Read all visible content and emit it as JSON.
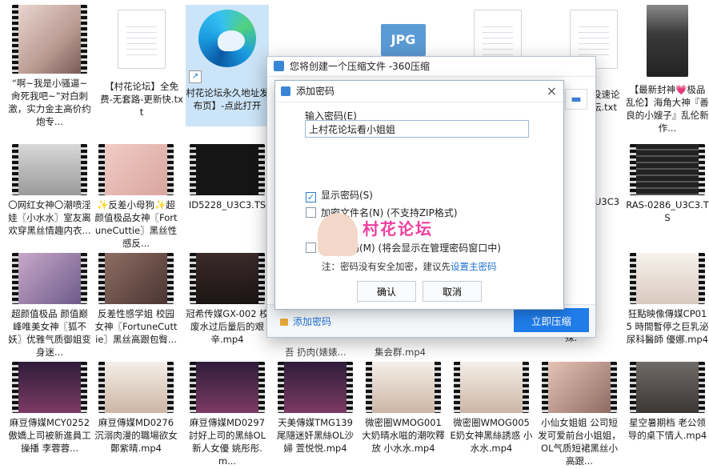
{
  "files": [
    {
      "label": "“啊~我是小骚逼~肏死我吧~”对白刺激，实力金主高价约炮专..."
    },
    {
      "label": "【村花论坛】全免费-无套路-更新快.txt"
    },
    {
      "label": "村花论坛永久地址发布页】-点此打开"
    },
    {
      "label": "JPG"
    },
    {
      "label": "没速论坛.txt"
    },
    {
      "label": "【最新封神💗极品乱伦】海角大神『善良的小嫂子』乱伦新作..."
    },
    {
      "label": "〇网红女神〇潮喷淫娃〖小水水〗室友离欢穿黑丝情趣内衣..."
    },
    {
      "label": "✨反差小母狗✨超颜值极品女神〖FortuneCuttie〗黑丝性感反..."
    },
    {
      "label": "ID5228_U3C3.TS"
    },
    {
      "label": "U3C3"
    },
    {
      "label": "RAS-0286_U3C3.TS"
    },
    {
      "label": "超颜值极品 颜值巅峰唯美女神〖狐不妖〗优雅气质御姐变身迷..."
    },
    {
      "label": "反差性感学姐 校园女神〖FortuneCuttie〗黑丝高跟包臀..."
    },
    {
      "label": "冠希传媒GX-002 校废水过后量后的艰辛.mp4"
    },
    {
      "label": "-035 体换 殊."
    },
    {
      "label": "狂點映像傳媒CP015 時間暫停之巨乳泌尿科醫師 優娜.mp4"
    },
    {
      "label": "麻豆傳媒MCY0252 傲嬌上司被新進員工操播 李蓉蓉..."
    },
    {
      "label": "麻豆傳媒MD0276 沉溺肉漫的職場欲女 鄭紫晴.mp4"
    },
    {
      "label": "麻豆傳媒MD0297 討好上司的黑絲OL 新人女優 姚彤彤.m..."
    },
    {
      "label": "天美傳媒TMG139 尾隨迷奸黑絲OL沙婦 萱悦悦.mp4"
    },
    {
      "label": "微密圈WMOG001 大奶晴水嗞的潮吹釋放 小水水.mp4"
    },
    {
      "label": "微密圈WMOG005 E奶女神黑絲誘惑 小水水.mp4"
    },
    {
      "label": "小仙女姐姐 公司短发可爱前台小姐姐，OL气质短裙黑丝小高跟..."
    },
    {
      "label": "星空暑期档 老公领导的桌下情人.mp4"
    },
    {
      "label": "包"
    },
    {
      "label": "吾 扔肉(婊婊..."
    },
    {
      "label": "集会群.mp4"
    }
  ],
  "outer_dialog": {
    "title": "您将创建一个压缩文件 -360压缩",
    "add_password": "添加密码",
    "compress_button": "立即压缩"
  },
  "inner_dialog": {
    "title": "添加密码",
    "close": "×",
    "input_label": "输入密码(E)",
    "password_value": "上村花论坛看小姐姐",
    "show_password": "显示密码(S)",
    "encrypt_filename": "加密文件名(N) (不支持ZIP格式)",
    "remember_password": "记住密码(M) (将会显示在管理密码窗口中)",
    "note_prefix": "注：密码没有安全加密，建议先",
    "note_link": "设置主密码",
    "ok": "确认",
    "cancel": "取消",
    "watermark": "村花论坛"
  },
  "colors": {
    "accent": "#1f7ce8",
    "link": "#1f6fd1",
    "selected_tile": "#cce4f7",
    "watermark": "#ee3f9f"
  }
}
